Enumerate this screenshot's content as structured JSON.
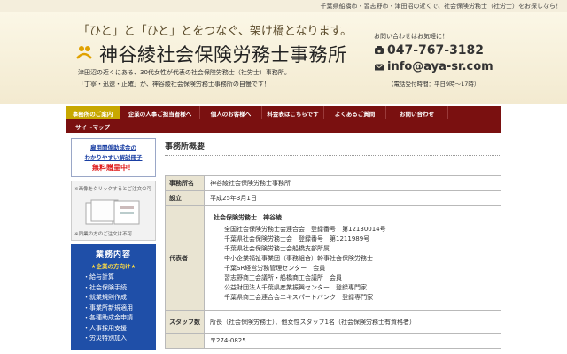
{
  "top": {
    "tagline": "千葉県船橋市・習志野市・津田沼の近くで、社会保険労務士（社労士）をお探しなら！"
  },
  "header": {
    "slogan": "「ひと」と「ひと」とをつなぐ、架け橋となります。",
    "office_name": "神谷綾社会保険労務士事務所",
    "intro_line1": "津田沼の近くにある、30代女性が代表の社会保険労務士（社労士）事務所。",
    "intro_line2": "「丁寧・迅速・正確」が、神谷綾社会保険労務士事務所の自慢です！"
  },
  "contact": {
    "lead": "お問い合わせはお気軽に！",
    "phone": "047-767-3182",
    "email": "info@aya-sr.com",
    "hours": "（電話受付時間：平日9時〜17時）"
  },
  "nav": {
    "row1": [
      "事務所のご案内",
      "企業の人事ご担当者様へ",
      "個人のお客様へ",
      "料金表はこちらです",
      "よくあるご質問",
      "お問い合わせ"
    ],
    "row2": [
      "サイトマップ"
    ]
  },
  "sidebar": {
    "banner_line1": "雇用関係助成金の",
    "banner_line2": "わかりやすい解説冊子",
    "banner_line3": "無料贈呈中！",
    "pamphlet_top": "※画像をクリックするとご注文の可",
    "pamphlet_caption": "※同業の方のご注文は不可",
    "services_title": "業務内容",
    "services_sub": "★企業の方向け★",
    "services": [
      "・給与計算",
      "・社会保険手続",
      "・就業規則作成",
      "・事業所新規適用",
      "・各種助成金申請",
      "・人事採用支援",
      "・労災特別加入"
    ]
  },
  "main": {
    "title": "事務所概要",
    "rows": {
      "name_label": "事務所名",
      "name_value": "神谷綾社会保険労務士事務所",
      "est_label": "設立",
      "est_value": "平成25年3月1日",
      "rep_label": "代表者",
      "rep_name": "社会保険労務士　神谷綾",
      "rep_lines": [
        "全国社会保険労務士会連合会　登録番号　第12130014号",
        "千葉県社会保険労務士会　登録番号　第1211989号",
        "千葉県社会保険労務士会船橋支部所属",
        "中小企業福祉事業団（事務組合）幹事社会保険労務士",
        "千葉SR経営労務管理センター　会員",
        "習志野商工会議所・船橋商工会議所　会員",
        "公益財団法人千葉県産業振興センター　登録専門家",
        "千葉県商工会連合会エキスパートバンク　登録専門家"
      ],
      "staff_label": "スタッフ数",
      "staff_value": "所長（社会保険労務士）、他女性スタッフ1名（社会保険労務士有資格者）",
      "addr_value": "〒274-0825"
    }
  },
  "colors": {
    "nav_bg": "#7a1010",
    "nav_active": "#c8a800",
    "service_bg": "#1f4fa8",
    "accent_red": "#d11111"
  }
}
